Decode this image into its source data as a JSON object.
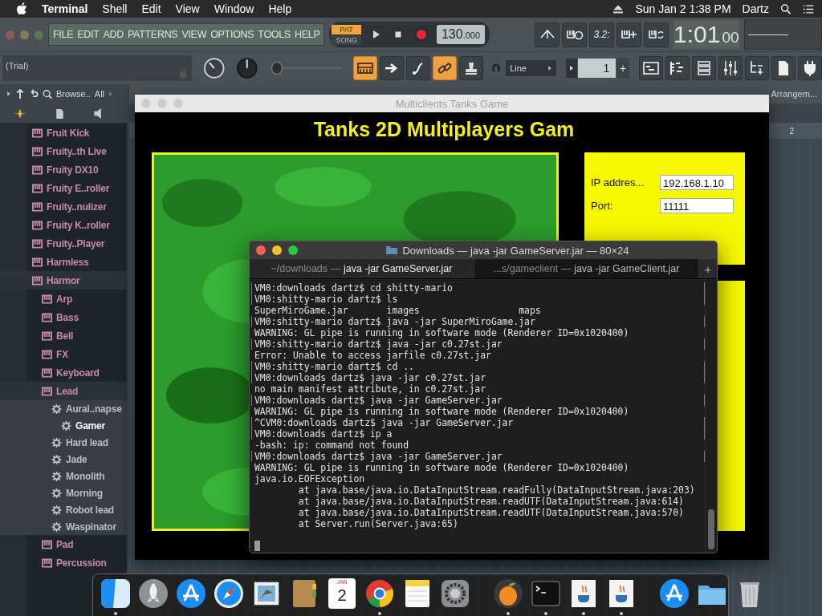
{
  "menubar": {
    "app": "Terminal",
    "menus": [
      "Shell",
      "Edit",
      "View",
      "Window",
      "Help"
    ],
    "clock": "Sun Jan 2  1:38 PM",
    "user": "Dartz"
  },
  "daw": {
    "menu": [
      "FILE",
      "EDIT",
      "ADD",
      "PATTERNS",
      "VIEW",
      "OPTIONS",
      "TOOLS",
      "HELP"
    ],
    "mode": [
      {
        "label": "PAT",
        "selected": true
      },
      {
        "label": "SONG",
        "selected": false
      }
    ],
    "tempo": "130",
    "tempo_fraction": ".000",
    "countdown": "3.2:",
    "time": "1:01",
    "time_ticks": "00",
    "hint": "(Trial)",
    "tools": [
      {
        "kind": "keyboard",
        "on": true
      },
      {
        "kind": "arrow",
        "on": false
      },
      {
        "kind": "pen",
        "on": false
      },
      {
        "kind": "link",
        "on": true
      },
      {
        "kind": "stamp",
        "on": false
      }
    ],
    "snap": "Line",
    "pattern": "1",
    "plus": "+",
    "browser": {
      "label": "Browse..",
      "filter": "All",
      "tree": [
        {
          "label": "Fruit Kick",
          "kind": "plugin",
          "selected": false
        },
        {
          "label": "Fruity..th Live",
          "kind": "plugin",
          "selected": false
        },
        {
          "label": "Fruity DX10",
          "kind": "plugin",
          "selected": false
        },
        {
          "label": "Fruity E..roller",
          "kind": "plugin",
          "selected": false
        },
        {
          "label": "Fruity..nulizer",
          "kind": "plugin",
          "selected": false
        },
        {
          "label": "Fruity K..roller",
          "kind": "plugin",
          "selected": false
        },
        {
          "label": "Fruity..Player",
          "kind": "plugin",
          "selected": false
        },
        {
          "label": "Harmless",
          "kind": "plugin",
          "selected": false
        },
        {
          "label": "Harmor",
          "kind": "plugin",
          "selected": false,
          "children": [
            {
              "label": "Arp",
              "kind": "plugin",
              "selected": false
            },
            {
              "label": "Bass",
              "kind": "plugin",
              "selected": false
            },
            {
              "label": "Bell",
              "kind": "plugin",
              "selected": false
            },
            {
              "label": "FX",
              "kind": "plugin",
              "selected": false
            },
            {
              "label": "Keyboard",
              "kind": "plugin",
              "selected": false
            },
            {
              "label": "Lead",
              "kind": "plugin",
              "selected": false,
              "children": [
                {
                  "label": "Aural..napse",
                  "kind": "preset",
                  "selected": false,
                  "children": [
                    {
                      "label": "Gamer",
                      "kind": "preset",
                      "selected": true
                    }
                  ]
                },
                {
                  "label": "Hard lead",
                  "kind": "preset",
                  "selected": false
                },
                {
                  "label": "Jade",
                  "kind": "preset",
                  "selected": false
                },
                {
                  "label": "Monolith",
                  "kind": "preset",
                  "selected": false
                },
                {
                  "label": "Morning",
                  "kind": "preset",
                  "selected": false
                },
                {
                  "label": "Robot lead",
                  "kind": "preset",
                  "selected": false
                },
                {
                  "label": "Waspinator",
                  "kind": "preset",
                  "selected": false
                }
              ]
            },
            {
              "label": "Pad",
              "kind": "plugin",
              "selected": false
            },
            {
              "label": "Percussion",
              "kind": "plugin",
              "selected": false
            }
          ]
        }
      ]
    },
    "playlist": {
      "title": "Arrangem...",
      "bar": "2"
    }
  },
  "game": {
    "title": "Multiclients Tanks Game",
    "heading": "Tanks 2D Multiplayers Gam",
    "fields": [
      {
        "label": "IP addres...",
        "value": "192.168.1.10"
      },
      {
        "label": "Port:",
        "value": "11111"
      }
    ]
  },
  "terminal": {
    "title": "Downloads — java -jar GameServer.jar — 80×24",
    "tabs": [
      {
        "path": "~/downloads —",
        "command": "java -jar GameServer.jar",
        "selected": true
      },
      {
        "path": "...s/gameclient —",
        "command": "java -jar GameClient.jar",
        "selected": false
      }
    ],
    "new_tab": "+",
    "lines": [
      {
        "kind": "prompt",
        "text": "VM0:downloads dartz$ cd shitty-mario"
      },
      {
        "kind": "prompt",
        "text": "VM0:shitty-mario dartz$ ls"
      },
      {
        "kind": "output",
        "text": "SuperMiroGame.jar       images                  maps"
      },
      {
        "kind": "prompt",
        "text": "VM0:shitty-mario dartz$ java -jar SuperMiroGame.jar"
      },
      {
        "kind": "output",
        "text": "WARNING: GL pipe is running in software mode (Renderer ID=0x1020400)"
      },
      {
        "kind": "prompt",
        "text": "VM0:shitty-mario dartz$ java -jar c0.27st.jar"
      },
      {
        "kind": "output",
        "text": "Error: Unable to access jarfile c0.27st.jar"
      },
      {
        "kind": "prompt",
        "text": "VM0:shitty-mario dartz$ cd .."
      },
      {
        "kind": "prompt",
        "text": "VM0:downloads dartz$ java -jar c0.27st.jar"
      },
      {
        "kind": "output",
        "text": "no main manifest attribute, in c0.27st.jar"
      },
      {
        "kind": "prompt",
        "text": "VM0:downloads dartz$ java -jar GameServer.jar"
      },
      {
        "kind": "output",
        "text": "WARNING: GL pipe is running in software mode (Renderer ID=0x1020400)"
      },
      {
        "kind": "prompt",
        "text": "^CVM0:downloads dartz$ java -jar GameServer.jar"
      },
      {
        "kind": "prompt",
        "text": "VM0:downloads dartz$ ip a"
      },
      {
        "kind": "output",
        "text": "-bash: ip: command not found"
      },
      {
        "kind": "prompt",
        "text": "VM0:downloads dartz$ java -jar GameServer.jar"
      },
      {
        "kind": "output",
        "text": "WARNING: GL pipe is running in software mode (Renderer ID=0x1020400)"
      },
      {
        "kind": "output",
        "text": "java.io.EOFException"
      },
      {
        "kind": "output",
        "text": "        at java.base/java.io.DataInputStream.readFully(DataInputStream.java:203)"
      },
      {
        "kind": "output",
        "text": "        at java.base/java.io.DataInputStream.readUTF(DataInputStream.java:614)"
      },
      {
        "kind": "output",
        "text": "        at java.base/java.io.DataInputStream.readUTF(DataInputStream.java:570)"
      },
      {
        "kind": "output",
        "text": "        at Server.run(Server.java:65)"
      }
    ]
  },
  "dock": [
    {
      "kind": "finder",
      "running": true
    },
    {
      "kind": "launchpad",
      "running": false
    },
    {
      "kind": "appstore",
      "running": false
    },
    {
      "kind": "safari",
      "running": false
    },
    {
      "kind": "mail",
      "running": false
    },
    {
      "kind": "contacts",
      "running": false
    },
    {
      "kind": "calendar",
      "running": false,
      "month": "JAN",
      "day": "2"
    },
    {
      "kind": "chrome",
      "running": true
    },
    {
      "kind": "notes",
      "running": false
    },
    {
      "kind": "settings",
      "running": false
    },
    {
      "kind": "separator"
    },
    {
      "kind": "fl",
      "running": true
    },
    {
      "kind": "terminal",
      "running": true
    },
    {
      "kind": "java",
      "running": true
    },
    {
      "kind": "java",
      "running": true
    },
    {
      "kind": "separator"
    },
    {
      "kind": "appstore",
      "running": false
    },
    {
      "kind": "folder",
      "running": false
    },
    {
      "kind": "trash",
      "running": false
    }
  ]
}
